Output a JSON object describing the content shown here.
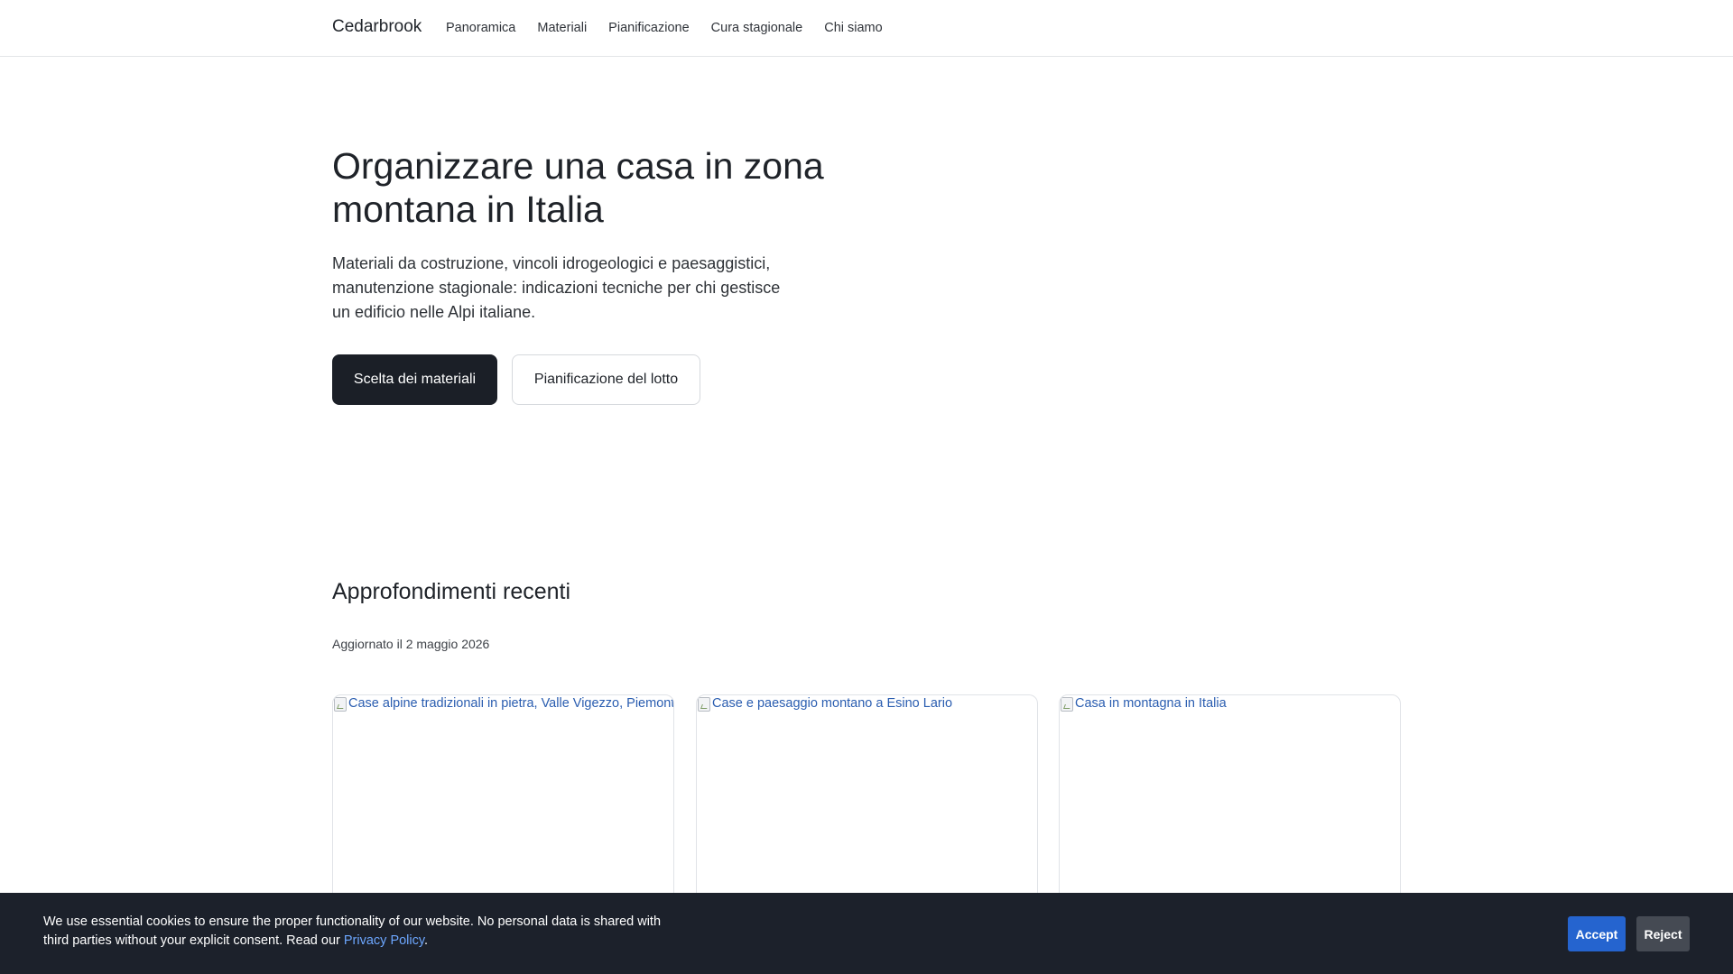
{
  "header": {
    "brand": "Cedarbrook",
    "nav": [
      "Panoramica",
      "Materiali",
      "Pianificazione",
      "Cura stagionale",
      "Chi siamo"
    ]
  },
  "hero": {
    "title": "Organizzare una casa in zona montana in Italia",
    "lead": "Materiali da costruzione, vincoli idrogeologici e paesaggistici, manutenzione stagionale: indicazioni tecniche per chi gestisce un edificio nelle Alpi italiane.",
    "primary_button": "Scelta dei materiali",
    "secondary_button": "Pianificazione del lotto"
  },
  "recent": {
    "title": "Approfondimenti recenti",
    "updated": "Aggiornato il 2 maggio 2026",
    "cards": [
      {
        "image_alt": "Case alpine tradizionali in pietra, Valle Vigezzo, Piemonte"
      },
      {
        "image_alt": "Case e paesaggio montano a Esino Lario"
      },
      {
        "image_alt": "Casa in montagna in Italia"
      }
    ]
  },
  "cookie": {
    "text_before_link": "We use essential cookies to ensure the proper functionality of our website. No personal data is shared with third parties without your explicit consent. Read our ",
    "link": "Privacy Policy",
    "text_after_link": ".",
    "accept": "Accept",
    "reject": "Reject"
  },
  "colors": {
    "primary_button": "#1b1f27",
    "link": "#2a5db0",
    "cookie_bg": "#1c212b",
    "accept": "#2564cf",
    "reject": "#454a53"
  }
}
